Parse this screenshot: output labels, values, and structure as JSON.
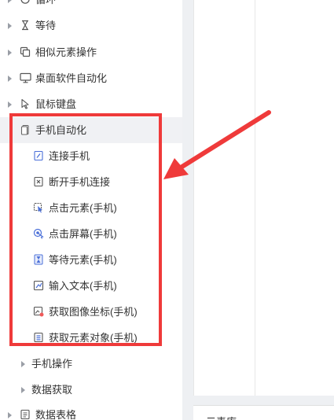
{
  "tree": {
    "items": [
      {
        "label": "循环",
        "icon": "loop-icon"
      },
      {
        "label": "等待",
        "icon": "hourglass-icon"
      },
      {
        "label": "相似元素操作",
        "icon": "copy-icon"
      },
      {
        "label": "桌面软件自动化",
        "icon": "monitor-icon"
      },
      {
        "label": "鼠标键盘",
        "icon": "cursor-icon"
      }
    ],
    "mobile_group": {
      "label": "手机自动化",
      "icon": "phone-icon",
      "children": [
        {
          "label": "连接手机",
          "icon": "link-icon"
        },
        {
          "label": "断开手机连接",
          "icon": "disconnect-icon"
        },
        {
          "label": "点击元素(手机)",
          "icon": "tap-element-icon"
        },
        {
          "label": "点击屏幕(手机)",
          "icon": "tap-screen-icon"
        },
        {
          "label": "等待元素(手机)",
          "icon": "wait-element-icon"
        },
        {
          "label": "输入文本(手机)",
          "icon": "input-text-icon"
        },
        {
          "label": "获取图像坐标(手机)",
          "icon": "image-coordinate-icon"
        },
        {
          "label": "获取元素对象(手机)",
          "icon": "element-object-icon"
        }
      ],
      "subgroups": [
        {
          "label": "手机操作"
        },
        {
          "label": "数据获取"
        }
      ]
    },
    "after_items": [
      {
        "label": "数据表格",
        "icon": "table-doc-icon"
      }
    ]
  },
  "properties": {
    "title": "元素库"
  },
  "colors": {
    "highlight": "#ef3a3a",
    "selected_row": "#f0f1f4",
    "icon_blue": "#4a6fd8",
    "gutter": "#eef0f3"
  }
}
